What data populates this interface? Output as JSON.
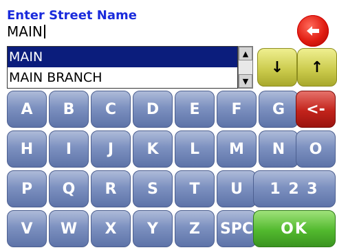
{
  "header": {
    "title": "Enter Street Name",
    "input_value": "MAIN"
  },
  "results": [
    "MAIN",
    "MAIN BRANCH"
  ],
  "nav": {
    "down": "↓",
    "up": "↑"
  },
  "keyboard": {
    "row1": [
      "A",
      "B",
      "C",
      "D",
      "E",
      "F",
      "G"
    ],
    "row2": [
      "H",
      "I",
      "J",
      "K",
      "L",
      "M",
      "N",
      "O"
    ],
    "row3": [
      "P",
      "Q",
      "R",
      "S",
      "T",
      "U"
    ],
    "row4": [
      "V",
      "W",
      "X",
      "Y",
      "Z"
    ],
    "backspace": "<-",
    "numbers": "1 2 3",
    "space": "SPC",
    "ok": "OK"
  },
  "colors": {
    "title": "#1a2bdc",
    "selection": "#0b1d7c",
    "key_blue": "#7d91c0",
    "key_red": "#c2231b",
    "key_green": "#52b92e",
    "arrow_yellow": "#c9c94a"
  }
}
